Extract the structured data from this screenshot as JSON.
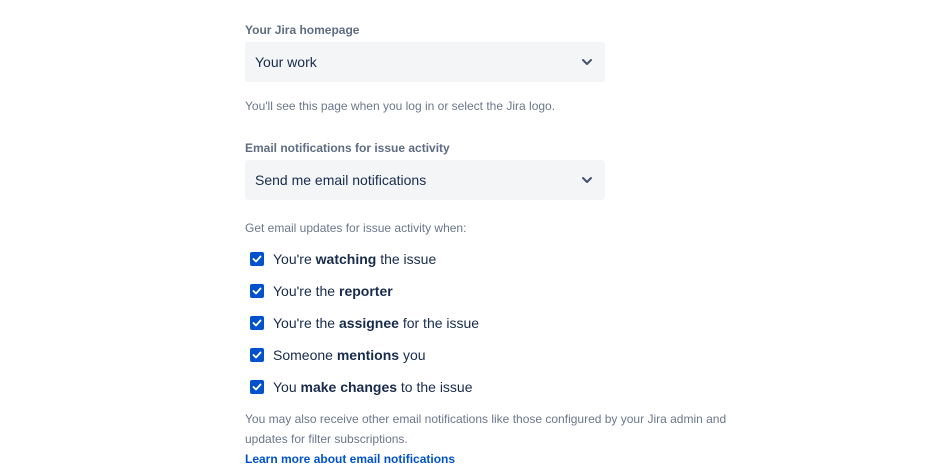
{
  "homepage": {
    "label": "Your Jira homepage",
    "selected": "Your work",
    "help": "You'll see this page when you log in or select the Jira logo."
  },
  "email": {
    "label": "Email notifications for issue activity",
    "selected": "Send me email notifications",
    "prompt": "Get email updates for issue activity when:",
    "options": [
      {
        "before": "You're ",
        "bold": "watching",
        "after": " the issue",
        "checked": true
      },
      {
        "before": "You're the ",
        "bold": "reporter",
        "after": "",
        "checked": true
      },
      {
        "before": "You're the ",
        "bold": "assignee",
        "after": " for the issue",
        "checked": true
      },
      {
        "before": "Someone ",
        "bold": "mentions",
        "after": " you",
        "checked": true
      },
      {
        "before": "You ",
        "bold": "make changes",
        "after": " to the issue",
        "checked": true
      }
    ],
    "footer": "You may also receive other email notifications like those configured by your Jira admin and updates for filter subscriptions.",
    "link": "Learn more about email notifications"
  },
  "colors": {
    "accent": "#0052cc",
    "field_bg": "#f4f5f7",
    "text": "#172b4d",
    "subtle": "#6b778c"
  }
}
